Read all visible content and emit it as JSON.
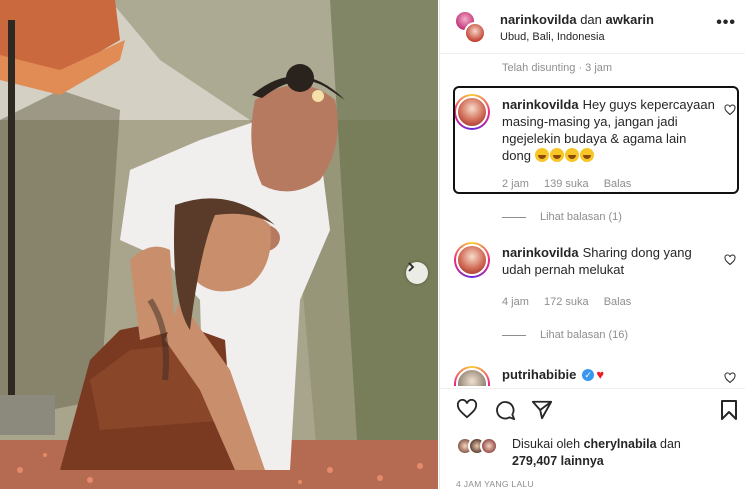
{
  "header": {
    "user_primary": "narinkovilda",
    "connector": "dan",
    "user_secondary": "awkarin",
    "location": "Ubud, Bali, Indonesia",
    "more_label": "•••"
  },
  "edited_note": "Telah disunting · 3 jam",
  "comments": [
    {
      "username": "narinkovilda",
      "text": "Hey guys kepercayaan masing-masing ya, jangan jadi ngejelekin budaya & agama lain dong",
      "emoji": "😂😂😂😂",
      "time": "2 jam",
      "likes": "139 suka",
      "reply_label": "Balas",
      "view_replies": "Lihat balasan (1)"
    },
    {
      "username": "narinkovilda",
      "text": "Sharing dong yang udah pernah melukat",
      "time": "4 jam",
      "likes": "172 suka",
      "reply_label": "Balas",
      "view_replies": "Lihat balasan (16)"
    },
    {
      "username": "putrihabibie"
    }
  ],
  "likes": {
    "prefix": "Disukai oleh",
    "user": "cherylnabila",
    "connector": "dan",
    "count": "279,407 lainnya"
  },
  "time_ago": "4 JAM YANG LALU",
  "colors": {
    "secondary_text": "#8e8e8e",
    "verified": "#3897f0",
    "heart": "#ed1b24"
  },
  "icons": [
    "heart-icon",
    "comment-icon",
    "share-icon",
    "bookmark-icon",
    "chevron-right-icon"
  ]
}
